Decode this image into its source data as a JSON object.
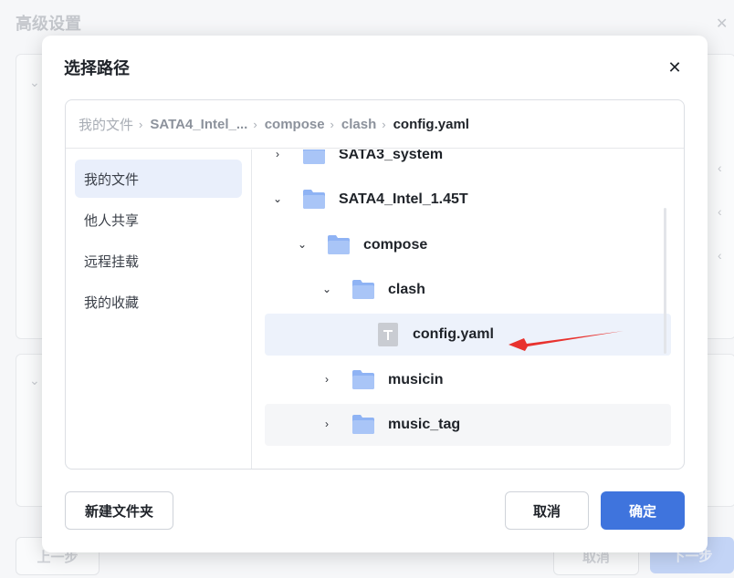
{
  "background": {
    "title": "高级设置",
    "prev_label": "上一步",
    "cancel_label": "取消",
    "next_label": "下一步"
  },
  "dialog": {
    "title": "选择路径",
    "breadcrumb": [
      "我的文件",
      "SATA4_Intel_...",
      "compose",
      "clash",
      "config.yaml"
    ],
    "sidebar": [
      "我的文件",
      "他人共享",
      "远程挂载",
      "我的收藏"
    ],
    "tree": [
      {
        "name": "SATA3_system",
        "type": "folder",
        "level": 0,
        "expanded": false
      },
      {
        "name": "SATA4_Intel_1.45T",
        "type": "folder",
        "level": 0,
        "expanded": true
      },
      {
        "name": "compose",
        "type": "folder",
        "level": 1,
        "expanded": true
      },
      {
        "name": "clash",
        "type": "folder",
        "level": 2,
        "expanded": true
      },
      {
        "name": "config.yaml",
        "type": "file",
        "level": 3,
        "selected": true
      },
      {
        "name": "musicin",
        "type": "folder",
        "level": 2,
        "expanded": false
      },
      {
        "name": "music_tag",
        "type": "folder",
        "level": 2,
        "expanded": false
      }
    ],
    "new_folder_label": "新建文件夹",
    "cancel_label": "取消",
    "confirm_label": "确定"
  },
  "colors": {
    "accent": "#3f74dd",
    "folder": "#8fb3f4",
    "selected_row": "#edf2fb",
    "annotation_arrow": "#e8322e"
  }
}
